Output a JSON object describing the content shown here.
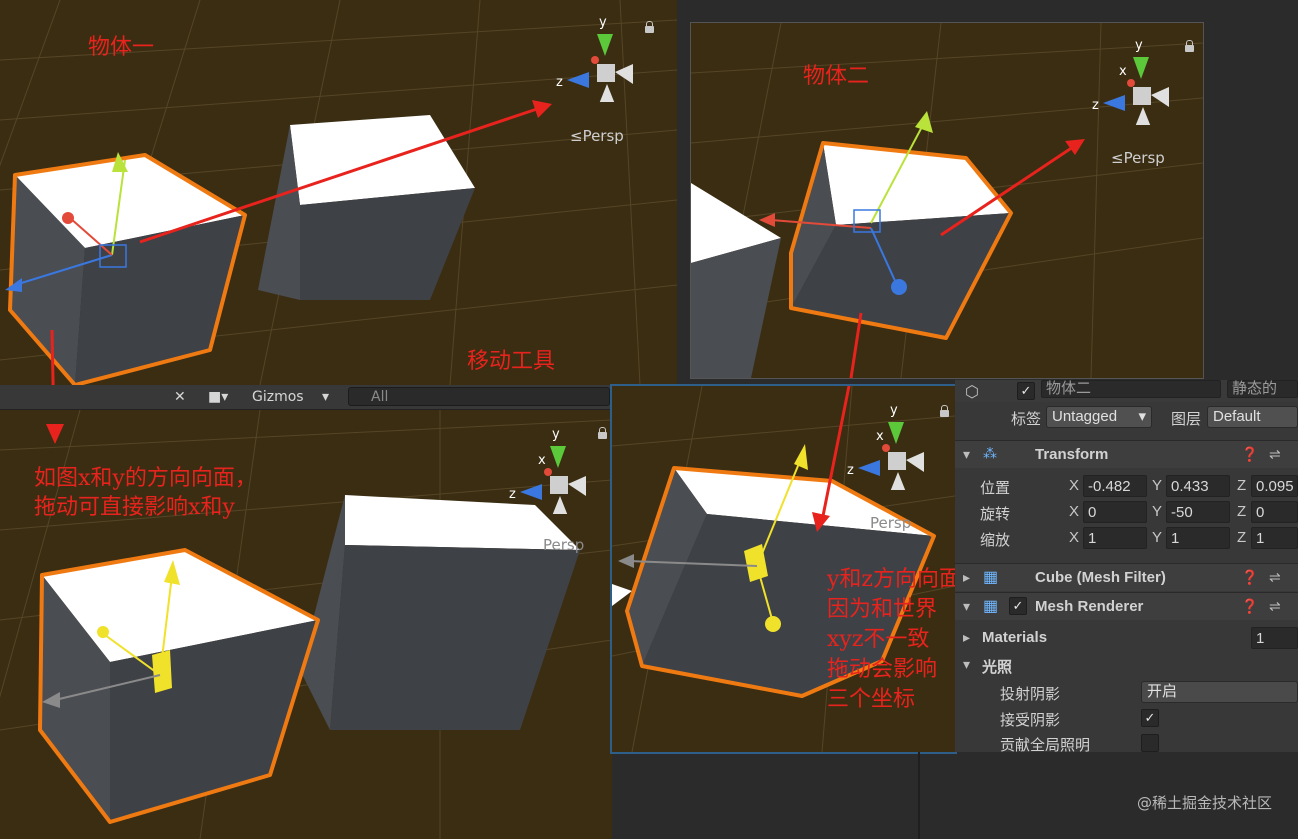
{
  "panels": {
    "top_left": {
      "persp_label": "≤Persp",
      "annotation": "物体一",
      "tool_annotation": "移动工具"
    },
    "top_right": {
      "persp_label": "≤Persp",
      "annotation": "物体二"
    },
    "bottom_left": {
      "persp_label": "Persp",
      "annotation_lines": [
        "如图x和y的方向向面，",
        "拖动可直接影响x和y"
      ]
    },
    "bottom_right": {
      "persp_label": "Persp",
      "annotation_lines": [
        "y和z方向向面",
        "因为和世界",
        "xyz不一致",
        "拖动会影响",
        "三个坐标"
      ]
    }
  },
  "gizmo_axes": {
    "x": "x",
    "y": "y",
    "z": "z"
  },
  "toolbar": {
    "gizmos_label": "Gizmos",
    "search_placeholder": "All"
  },
  "inspector": {
    "object_name": "物体二",
    "static_label": "静态的",
    "tag_label": "标签",
    "tag_value": "Untagged",
    "layer_label": "图层",
    "layer_value": "Default",
    "transform": {
      "title": "Transform",
      "position_label": "位置",
      "rotation_label": "旋转",
      "scale_label": "缩放",
      "position": {
        "x": "-0.482",
        "y": "0.433",
        "z": "0.095"
      },
      "rotation": {
        "x": "0",
        "y": "-50",
        "z": "0"
      },
      "scale": {
        "x": "1",
        "y": "1",
        "z": "1"
      }
    },
    "mesh_filter_title": "Cube (Mesh Filter)",
    "mesh_renderer_title": "Mesh Renderer",
    "materials_label": "Materials",
    "materials_count": "1",
    "lighting_label": "光照",
    "cast_shadows_label": "投射阴影",
    "cast_shadows_value": "开启",
    "receive_shadows_label": "接受阴影",
    "gi_label": "贡献全局照明"
  },
  "watermark": "@稀土掘金技术社区",
  "colors": {
    "annotation": "#e8231d",
    "selection": "#f07a12",
    "scene_bg": "#3b2d12",
    "frame": "#2e5f8a"
  }
}
